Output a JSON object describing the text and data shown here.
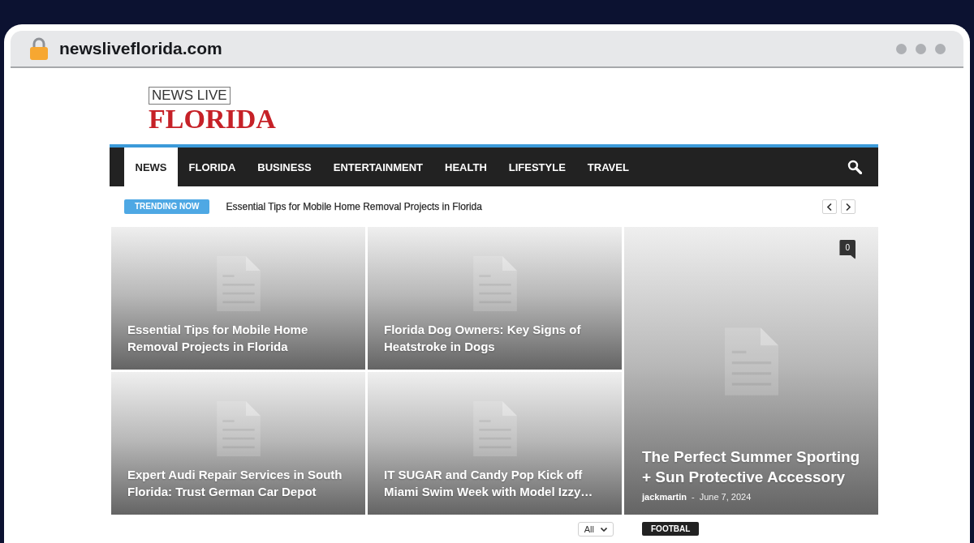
{
  "browser": {
    "url": "newsliveflorida.com"
  },
  "logo": {
    "top": "NEWS LIVE",
    "bottom": "FLORIDA"
  },
  "nav": {
    "items": [
      {
        "label": "NEWS",
        "selected": true
      },
      {
        "label": "FLORIDA",
        "selected": false
      },
      {
        "label": "BUSINESS",
        "selected": false
      },
      {
        "label": "ENTERTAINMENT",
        "selected": false
      },
      {
        "label": "HEALTH",
        "selected": false
      },
      {
        "label": "LIFESTYLE",
        "selected": false
      },
      {
        "label": "TRAVEL",
        "selected": false
      }
    ]
  },
  "trending": {
    "label": "TRENDING NOW",
    "headline": "Essential Tips for Mobile Home Removal Projects in Florida"
  },
  "featured": [
    {
      "kind": "small",
      "title": "Essential Tips for Mobile Home Removal Projects in Florida"
    },
    {
      "kind": "small",
      "title": "Florida Dog Owners: Key Signs of Heatstroke in Dogs"
    },
    {
      "kind": "small",
      "title": "Expert Audi Repair Services in South Florida: Trust German Car Depot"
    },
    {
      "kind": "small",
      "title": "IT SUGAR and Candy Pop Kick off Miami Swim Week with Model Izzy…"
    },
    {
      "kind": "large",
      "title": "The Perfect Summer Sporting + Sun Protective Accessory",
      "comments": "0",
      "author": "jackmartin",
      "separator": "-",
      "date": "June 7, 2024"
    }
  ],
  "below": {
    "filter": "All",
    "tag": "FOOTBAL"
  }
}
